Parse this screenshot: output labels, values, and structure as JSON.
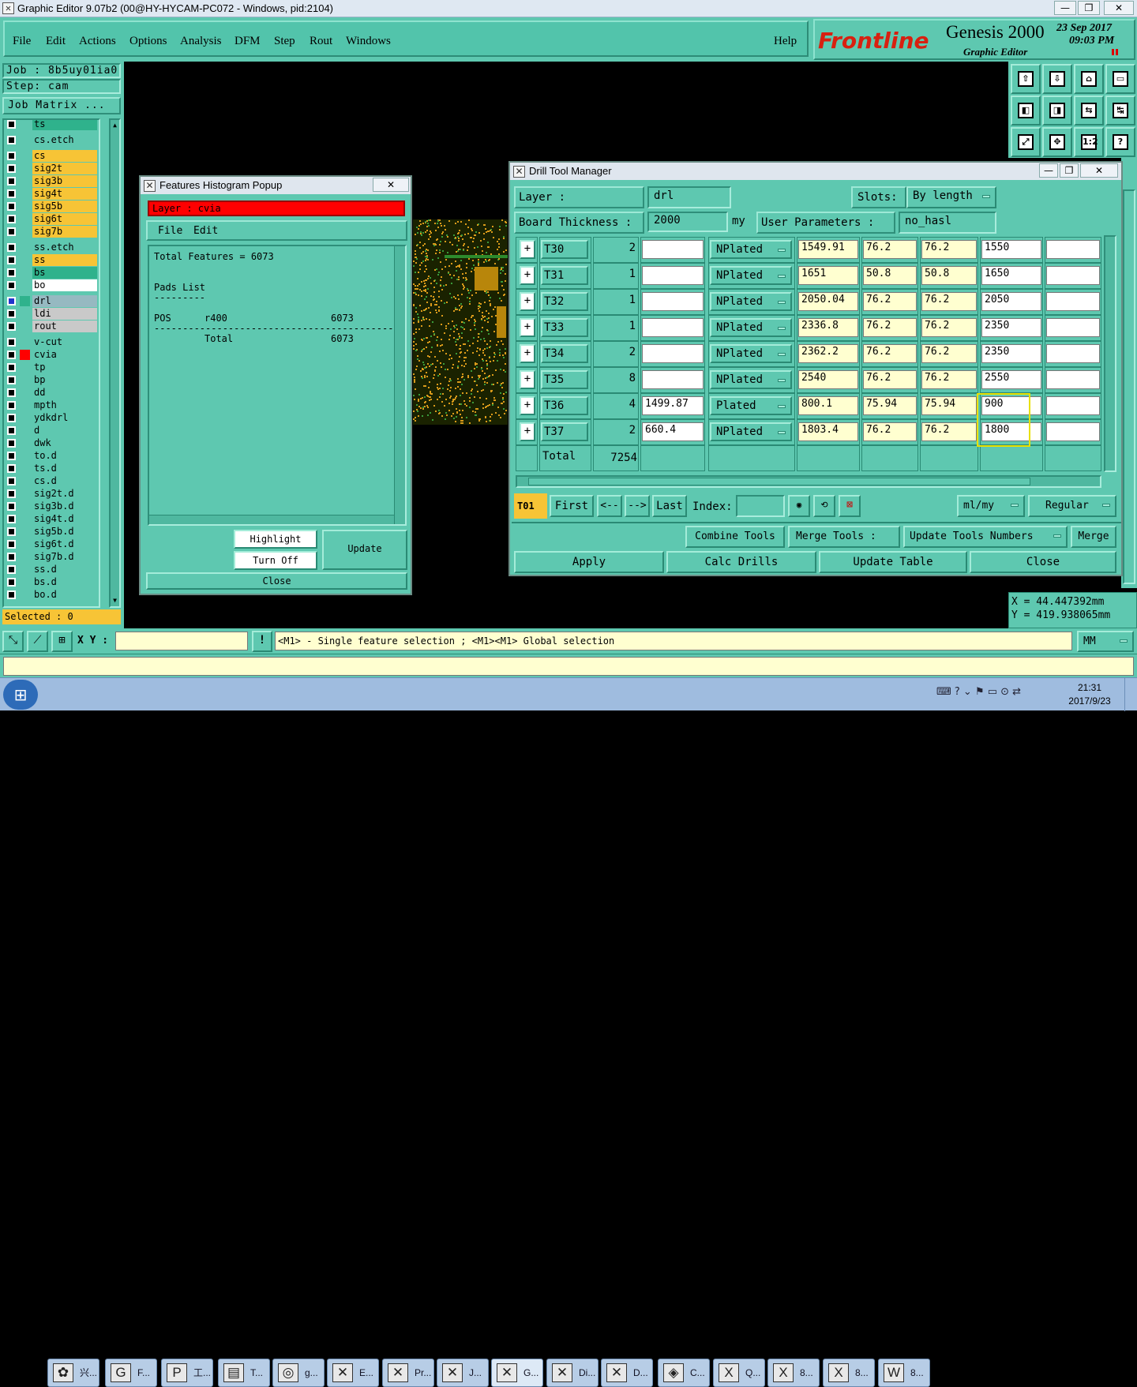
{
  "window": {
    "title": "Graphic Editor 9.07b2 (00@HY-HYCAM-PC072 - Windows, pid:2104)",
    "min": "—",
    "max": "❐",
    "close": "✕"
  },
  "menu": {
    "items": [
      "File",
      "Edit",
      "Actions",
      "Options",
      "Analysis",
      "DFM",
      "Step",
      "Rout",
      "Windows"
    ],
    "help": "Help"
  },
  "brand": {
    "logo": "Frontline",
    "product": "Genesis 2000",
    "subtitle": "Graphic Editor",
    "date": "23 Sep 2017",
    "time": "09:03 PM"
  },
  "job": {
    "job": "Job : 8b5uy01ia0",
    "step": "Step: cam",
    "matrix": "Job Matrix ..."
  },
  "layers": [
    {
      "name": "ts",
      "c": "c-g"
    },
    {
      "name": "cs.etch",
      "c": "c-t"
    },
    {
      "name": "cs",
      "c": "c-y"
    },
    {
      "name": "sig2t",
      "c": "c-y"
    },
    {
      "name": "sig3b",
      "c": "c-y"
    },
    {
      "name": "sig4t",
      "c": "c-y"
    },
    {
      "name": "sig5b",
      "c": "c-y"
    },
    {
      "name": "sig6t",
      "c": "c-y"
    },
    {
      "name": "sig7b",
      "c": "c-y"
    },
    {
      "name": "ss.etch",
      "c": "c-t"
    },
    {
      "name": "ss",
      "c": "c-y"
    },
    {
      "name": "bs",
      "c": "c-g"
    },
    {
      "name": "bo",
      "c": "c-w"
    },
    {
      "name": "drl",
      "c": "c-b"
    },
    {
      "name": "ldi",
      "c": "c-gr"
    },
    {
      "name": "rout",
      "c": "c-gr"
    },
    {
      "name": "v-cut",
      "c": "c-t"
    },
    {
      "name": "cvia",
      "c": "c-t"
    },
    {
      "name": "tp",
      "c": "c-t"
    },
    {
      "name": "bp",
      "c": "c-t"
    },
    {
      "name": "dd",
      "c": "c-t"
    },
    {
      "name": "mpth",
      "c": "c-t"
    },
    {
      "name": "ydkdrl",
      "c": "c-t"
    },
    {
      "name": "d",
      "c": "c-t"
    },
    {
      "name": "dwk",
      "c": "c-t"
    },
    {
      "name": "to.d",
      "c": "c-t"
    },
    {
      "name": "ts.d",
      "c": "c-t"
    },
    {
      "name": "cs.d",
      "c": "c-t"
    },
    {
      "name": "sig2t.d",
      "c": "c-t"
    },
    {
      "name": "sig3b.d",
      "c": "c-t"
    },
    {
      "name": "sig4t.d",
      "c": "c-t"
    },
    {
      "name": "sig5b.d",
      "c": "c-t"
    },
    {
      "name": "sig6t.d",
      "c": "c-t"
    },
    {
      "name": "sig7b.d",
      "c": "c-t"
    },
    {
      "name": "ss.d",
      "c": "c-t"
    },
    {
      "name": "bs.d",
      "c": "c-t"
    },
    {
      "name": "bo.d",
      "c": "c-t"
    }
  ],
  "selected": "Selected : 0",
  "histogram": {
    "title": "Features Histogram Popup",
    "layer": "Layer :  cvia",
    "file": "File",
    "edit": "Edit",
    "total": "Total Features = 6073",
    "pads": "Pads List",
    "dashes": "---------",
    "pos": "POS",
    "sym": "r400",
    "count": "6073",
    "total_label": "Total",
    "total_count": "6073",
    "rule": "------------------------------------------",
    "highlight": "Highlight",
    "turnoff": "Turn Off",
    "update": "Update",
    "close": "Close"
  },
  "dtm": {
    "title": "Drill Tool Manager",
    "layer_label": "Layer          :",
    "layer_val": "drl",
    "slots_label": "Slots:",
    "slots_val": "By length",
    "thick_label": "Board Thickness :",
    "thick_val": "2000",
    "thick_unit": "my",
    "userpar_label": "User Parameters :",
    "userpar_val": "no_hasl",
    "rows": [
      {
        "tool": "T30",
        "count": "2",
        "a": "",
        "type": "NPlated",
        "fin": "1549.91",
        "m1": "76.2",
        "m2": "76.2",
        "drill": "1550"
      },
      {
        "tool": "T31",
        "count": "1",
        "a": "",
        "type": "NPlated",
        "fin": "1651",
        "m1": "50.8",
        "m2": "50.8",
        "drill": "1650"
      },
      {
        "tool": "T32",
        "count": "1",
        "a": "",
        "type": "NPlated",
        "fin": "2050.04",
        "m1": "76.2",
        "m2": "76.2",
        "drill": "2050"
      },
      {
        "tool": "T33",
        "count": "1",
        "a": "",
        "type": "NPlated",
        "fin": "2336.8",
        "m1": "76.2",
        "m2": "76.2",
        "drill": "2350"
      },
      {
        "tool": "T34",
        "count": "2",
        "a": "",
        "type": "NPlated",
        "fin": "2362.2",
        "m1": "76.2",
        "m2": "76.2",
        "drill": "2350"
      },
      {
        "tool": "T35",
        "count": "8",
        "a": "",
        "type": "NPlated",
        "fin": "2540",
        "m1": "76.2",
        "m2": "76.2",
        "drill": "2550"
      },
      {
        "tool": "T36",
        "count": "4",
        "a": "1499.87",
        "type": "Plated",
        "fin": "800.1",
        "m1": "75.94",
        "m2": "75.94",
        "drill": "900"
      },
      {
        "tool": "T37",
        "count": "2",
        "a": "660.4",
        "type": "NPlated",
        "fin": "1803.4",
        "m1": "76.2",
        "m2": "76.2",
        "drill": "1800"
      }
    ],
    "total_label": "Total",
    "total_val": "7254",
    "nav_tool": "T01",
    "first": "First",
    "prev": "<--",
    "next": "-->",
    "last": "Last",
    "index": "Index:",
    "units": "ml/my",
    "mode": "Regular",
    "combine": "Combine Tools",
    "merge_tools": "Merge Tools :",
    "update_nums": "Update Tools Numbers",
    "merge": "Merge",
    "apply": "Apply",
    "calc": "Calc Drills",
    "update_table": "Update Table",
    "close": "Close"
  },
  "coords": {
    "x": "X = 44.447392mm",
    "y": "Y = 419.938065mm"
  },
  "status": {
    "xy": "X Y :",
    "msg": "<M1> - Single feature selection ; <M1><M1> Global selection",
    "unit": "MM"
  },
  "taskbar": {
    "items": [
      "兴...",
      "F...",
      "工...",
      "T...",
      "g...",
      "E...",
      "Pr...",
      "J...",
      "G...",
      "Di...",
      "D...",
      "C...",
      "Q...",
      "8...",
      "8...",
      "8..."
    ],
    "time": "21:31",
    "date": "2017/9/23"
  },
  "toolbar_icons": [
    "open-icon",
    "save-icon",
    "home-icon",
    "window-icon",
    "zoom-left-icon",
    "zoom-right-icon",
    "mirror-icon",
    "swap-icon",
    "fit-icon",
    "center-icon",
    "scale-12-icon",
    "help-icon"
  ],
  "toolbar_labels": [
    "⇧",
    "⇩",
    "⌂",
    "▭",
    "◧",
    "◨",
    "⇆",
    "↹",
    "⤢",
    "✥",
    "1:2",
    "?"
  ],
  "colors": {
    "teal": "#5ec8b0",
    "yellow": "#f7c436",
    "red": "#ff0000"
  }
}
